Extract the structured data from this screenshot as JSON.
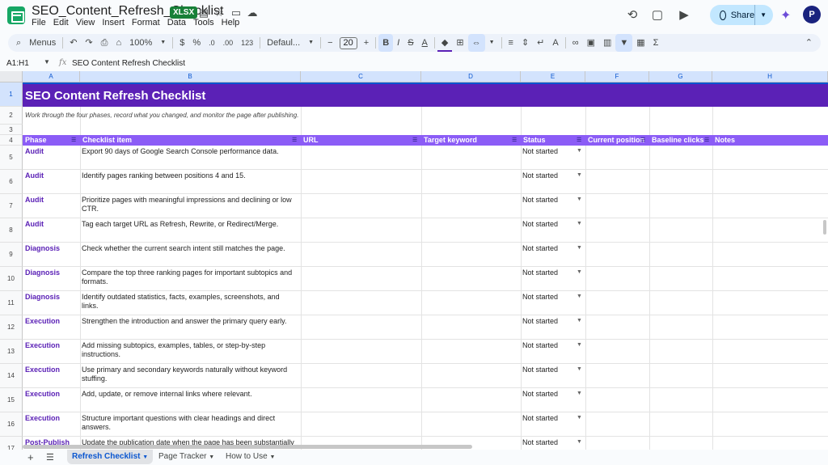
{
  "topbar": {
    "doc_title": "SEO_Content_Refresh_Checklist",
    "file_badge": "XLSX",
    "menus": [
      "File",
      "Edit",
      "View",
      "Insert",
      "Format",
      "Data",
      "Tools",
      "Help"
    ],
    "share_label": "Share",
    "avatar_initial": "P"
  },
  "toolbar": {
    "menus_label": "Menus",
    "zoom": "100%",
    "currency": "$",
    "percent": "%",
    "dec_decrease": ".0",
    "dec_increase": ".00",
    "number_format": "123",
    "font": "Defaul...",
    "font_size": "20"
  },
  "formula_bar": {
    "name_box": "A1:H1",
    "fx": "fx",
    "content": "SEO Content Refresh Checklist"
  },
  "columns": [
    "A",
    "B",
    "C",
    "D",
    "E",
    "F",
    "G",
    "H"
  ],
  "sheet": {
    "title": "SEO Content Refresh Checklist",
    "subtitle": "Work through the four phases, record what you changed, and monitor the page after publishing.",
    "headers": [
      "Phase",
      "Checklist item",
      "URL",
      "Target keyword",
      "Status",
      "Current position",
      "Baseline clicks",
      "Notes"
    ],
    "rows": [
      {
        "num": "5",
        "phase": "Audit",
        "item": "Export 90 days of Google Search Console performance data.",
        "status": "Not started"
      },
      {
        "num": "6",
        "phase": "Audit",
        "item": "Identify pages ranking between positions 4 and 15.",
        "status": "Not started"
      },
      {
        "num": "7",
        "phase": "Audit",
        "item": "Prioritize pages with meaningful impressions and declining or low CTR.",
        "status": "Not started"
      },
      {
        "num": "8",
        "phase": "Audit",
        "item": "Tag each target URL as Refresh, Rewrite, or Redirect/Merge.",
        "status": "Not started"
      },
      {
        "num": "9",
        "phase": "Diagnosis",
        "item": "Check whether the current search intent still matches the page.",
        "status": "Not started"
      },
      {
        "num": "10",
        "phase": "Diagnosis",
        "item": "Compare the top three ranking pages for important subtopics and formats.",
        "status": "Not started"
      },
      {
        "num": "11",
        "phase": "Diagnosis",
        "item": "Identify outdated statistics, facts, examples, screenshots, and links.",
        "status": "Not started"
      },
      {
        "num": "12",
        "phase": "Execution",
        "item": "Strengthen the introduction and answer the primary query early.",
        "status": "Not started"
      },
      {
        "num": "13",
        "phase": "Execution",
        "item": "Add missing subtopics, examples, tables, or step-by-step instructions.",
        "status": "Not started"
      },
      {
        "num": "14",
        "phase": "Execution",
        "item": "Use primary and secondary keywords naturally without keyword stuffing.",
        "status": "Not started"
      },
      {
        "num": "15",
        "phase": "Execution",
        "item": "Add, update, or remove internal links where relevant.",
        "status": "Not started"
      },
      {
        "num": "16",
        "phase": "Execution",
        "item": "Structure important questions with clear headings and direct answers.",
        "status": "Not started"
      },
      {
        "num": "17",
        "phase": "Post-Publish",
        "item": "Update the publication date when the page has been substantially",
        "status": "Not started"
      }
    ],
    "row_nums_top": [
      "1",
      "2",
      "3",
      "4"
    ]
  },
  "tabs": [
    {
      "label": "Refresh Checklist"
    },
    {
      "label": "Page Tracker"
    },
    {
      "label": "How to Use"
    }
  ],
  "colors": {
    "title_bg": "#5b21b6",
    "header_bg": "#8b5cf6",
    "phase_text": "#5b21b6"
  }
}
